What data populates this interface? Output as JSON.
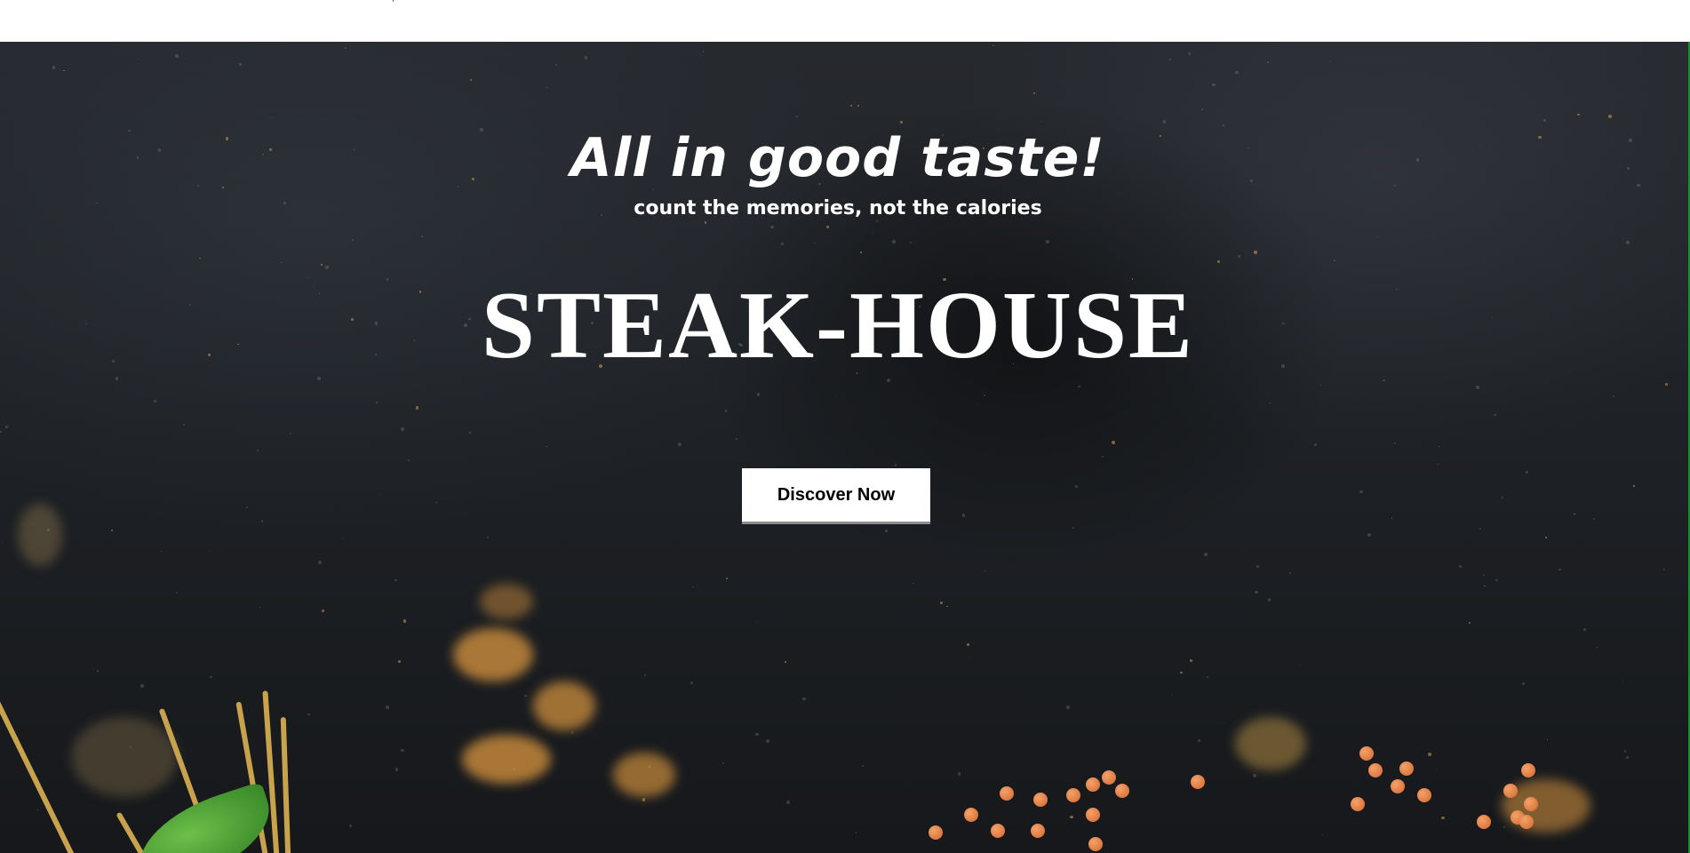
{
  "hero": {
    "tagline": "All in good taste!",
    "subline": "count the memories, not the calories",
    "brand": "STEAK-HOUSE",
    "cta_label": "Discover Now"
  },
  "colors": {
    "background_dark": "#1d2024",
    "text": "#ffffff",
    "button_bg": "#ffffff",
    "button_text": "#000000",
    "spice": "#d9953f",
    "lentil": "#e07a3c",
    "leaf": "#3e9a2c"
  }
}
